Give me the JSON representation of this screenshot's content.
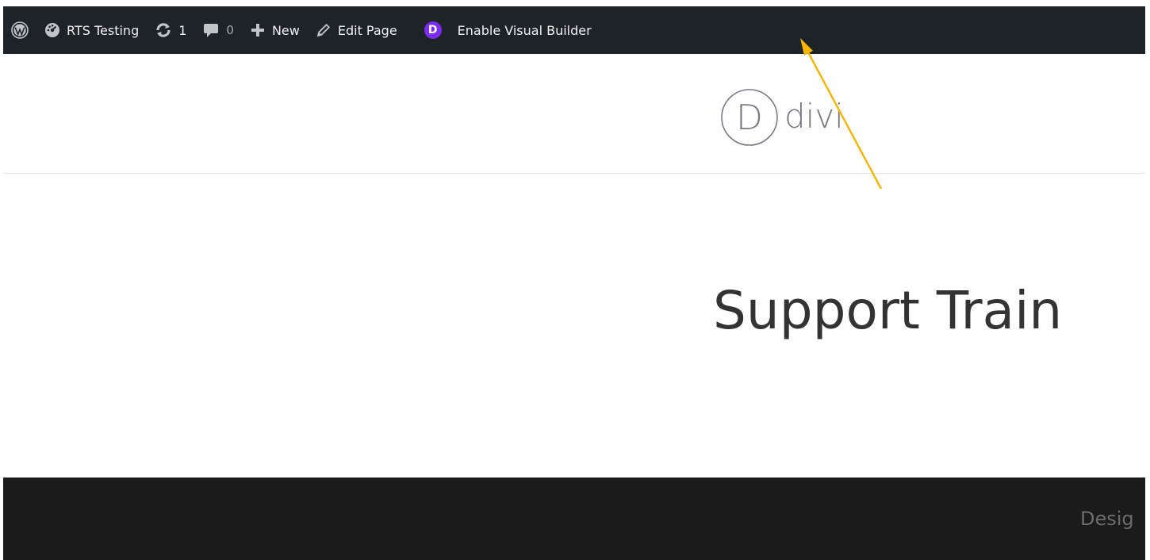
{
  "admin_bar": {
    "site_name": "RTS Testing",
    "updates_count": "1",
    "comments_count": "0",
    "new_label": "New",
    "edit_page_label": "Edit Page",
    "divi_badge_letter": "D",
    "visual_builder_label": "Enable Visual Builder",
    "icons": [
      "wordpress-icon",
      "dashboard-icon",
      "updates-icon",
      "comments-icon",
      "plus-icon",
      "pencil-icon",
      "divi-icon"
    ]
  },
  "header": {
    "logo_letter": "D",
    "logo_text": "divi"
  },
  "main": {
    "page_title": "Support Train"
  },
  "footer": {
    "credit_text": "Desig"
  },
  "colors": {
    "admin_bar_bg": "#1d2327",
    "divi_purple": "#7b2cf0",
    "footer_bg": "#1b1b1b",
    "annotation_arrow": "#f7b500"
  }
}
